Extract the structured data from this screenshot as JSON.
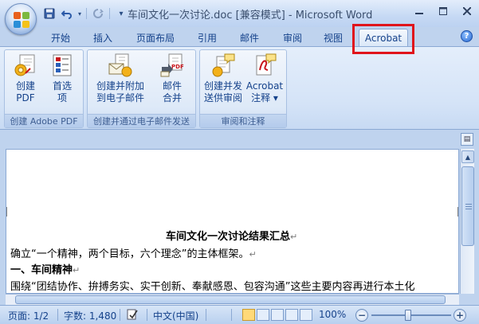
{
  "window": {
    "title": "车间文化一次讨论.doc [兼容模式] - Microsoft Word"
  },
  "qat": {
    "icons": [
      "save-icon",
      "undo-icon",
      "redo-icon",
      "customize-icon"
    ]
  },
  "tabs": [
    {
      "label": "开始",
      "active": false
    },
    {
      "label": "插入",
      "active": false
    },
    {
      "label": "页面布局",
      "active": false
    },
    {
      "label": "引用",
      "active": false
    },
    {
      "label": "邮件",
      "active": false
    },
    {
      "label": "审阅",
      "active": false
    },
    {
      "label": "视图",
      "active": false
    },
    {
      "label": "Acrobat",
      "active": true
    }
  ],
  "ribbon": {
    "groups": [
      {
        "label": "创建 Adobe PDF",
        "buttons": [
          {
            "line1": "创建",
            "line2": "PDF",
            "icon": "create-pdf-icon"
          },
          {
            "line1": "首选",
            "line2": "项",
            "icon": "preferences-icon"
          }
        ]
      },
      {
        "label": "创建并通过电子邮件发送",
        "buttons": [
          {
            "line1": "创建并附加",
            "line2": "到电子邮件",
            "icon": "attach-email-icon"
          },
          {
            "line1": "邮件",
            "line2": "合并",
            "icon": "mail-merge-icon"
          }
        ]
      },
      {
        "label": "审阅和注释",
        "buttons": [
          {
            "line1": "创建并发",
            "line2": "送供审阅",
            "icon": "send-review-icon"
          },
          {
            "line1": "Acrobat",
            "line2": "注释 ▾",
            "icon": "acrobat-comment-icon"
          }
        ]
      }
    ]
  },
  "document": {
    "lines": [
      {
        "text": "车间文化一次讨论结果汇总",
        "bold": true,
        "center": true
      },
      {
        "text": "确立“一个精神，两个目标，六个理念”的主体框架。",
        "bold": false
      },
      {
        "text": "一、车间精神",
        "bold": true
      },
      {
        "text": "围绕“团结协作、拚搏务实、实干创新、奉献感恩、包容沟通”这些主要内容再进行本土化",
        "bold": false
      }
    ],
    "paragraph_mark": "↵"
  },
  "status": {
    "page": "页面: 1/2",
    "words": "字数: 1,480",
    "language": "中文(中国)",
    "zoom": "100%"
  },
  "colors": {
    "highlight": "#e0141b",
    "ribbon_text": "#15428b"
  }
}
